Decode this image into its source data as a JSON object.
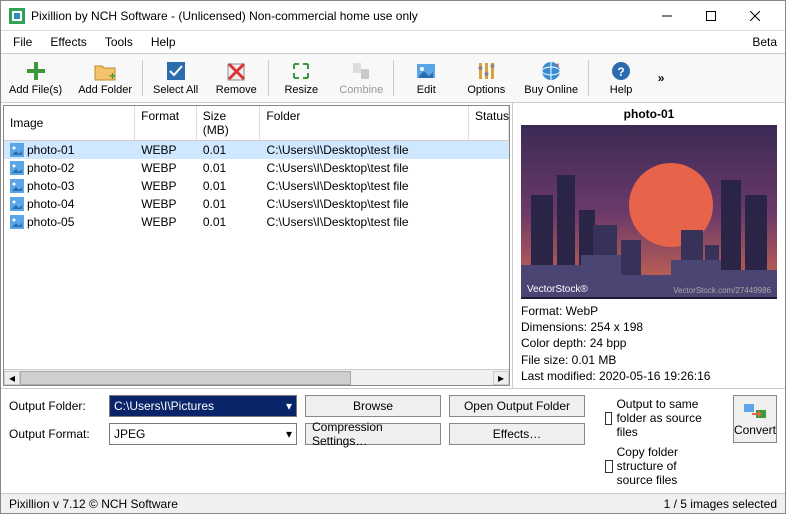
{
  "window": {
    "title": "Pixillion by NCH Software - (Unlicensed) Non-commercial home use only"
  },
  "menu": {
    "file": "File",
    "effects": "Effects",
    "tools": "Tools",
    "help": "Help",
    "beta": "Beta"
  },
  "toolbar": {
    "addfiles": "Add File(s)",
    "addfolder": "Add Folder",
    "selectall": "Select All",
    "remove": "Remove",
    "resize": "Resize",
    "combine": "Combine",
    "edit": "Edit",
    "options": "Options",
    "buyonline": "Buy Online",
    "help": "Help"
  },
  "columns": {
    "image": "Image",
    "format": "Format",
    "size": "Size (MB)",
    "folder": "Folder",
    "status": "Status"
  },
  "rows": [
    {
      "name": "photo-01",
      "format": "WEBP",
      "size": "0.01",
      "folder": "C:\\Users\\I\\Desktop\\test file",
      "sel": true
    },
    {
      "name": "photo-02",
      "format": "WEBP",
      "size": "0.01",
      "folder": "C:\\Users\\I\\Desktop\\test file",
      "sel": false
    },
    {
      "name": "photo-03",
      "format": "WEBP",
      "size": "0.01",
      "folder": "C:\\Users\\I\\Desktop\\test file",
      "sel": false
    },
    {
      "name": "photo-04",
      "format": "WEBP",
      "size": "0.01",
      "folder": "C:\\Users\\I\\Desktop\\test file",
      "sel": false
    },
    {
      "name": "photo-05",
      "format": "WEBP",
      "size": "0.01",
      "folder": "C:\\Users\\I\\Desktop\\test file",
      "sel": false
    }
  ],
  "preview": {
    "title": "photo-01",
    "watermark_left": "VectorStock®",
    "watermark_right": "VectorStock.com/27449986",
    "meta_format": "Format: WebP",
    "meta_dim": "Dimensions: 254 x 198",
    "meta_depth": "Color depth: 24 bpp",
    "meta_size": "File size: 0.01 MB",
    "meta_mod": "Last modified: 2020-05-16 19:26:16"
  },
  "output": {
    "folder_label": "Output Folder:",
    "folder_value": "C:\\Users\\I\\Pictures",
    "browse": "Browse",
    "open_output": "Open Output Folder",
    "format_label": "Output Format:",
    "format_value": "JPEG",
    "compression": "Compression Settings…",
    "effects": "Effects…",
    "chk_same": "Output to same folder as source files",
    "chk_copy": "Copy folder structure of source files",
    "convert": "Convert"
  },
  "status": {
    "left": "Pixillion v 7.12 © NCH Software",
    "right": "1 / 5 images selected"
  }
}
